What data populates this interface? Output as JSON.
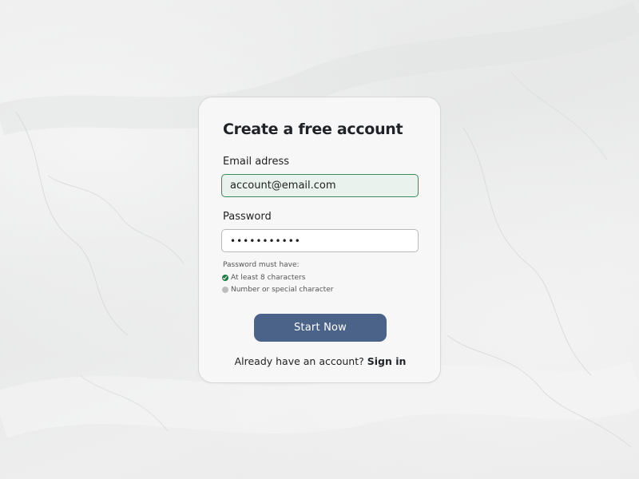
{
  "form": {
    "title": "Create a free account",
    "email": {
      "label": "Email adress",
      "value": "account@email.com",
      "state": "valid"
    },
    "password": {
      "label": "Password",
      "value": "•••••••••••"
    },
    "requirements": {
      "heading": "Password must have:",
      "items": [
        {
          "text": "At least 8 characters",
          "met": true,
          "icon": "check-circle-icon"
        },
        {
          "text": "Number or special character",
          "met": false,
          "icon": "pending-circle-icon"
        }
      ]
    },
    "submit_label": "Start Now",
    "footer": {
      "prompt": "Already have an account?",
      "link_label": "Sign in"
    }
  },
  "colors": {
    "accent": "#4b6388",
    "valid_border": "#3f8a5b",
    "valid_fill": "#e9f2ec",
    "check": "#1f7a45",
    "pending": "#bdbdbd"
  }
}
